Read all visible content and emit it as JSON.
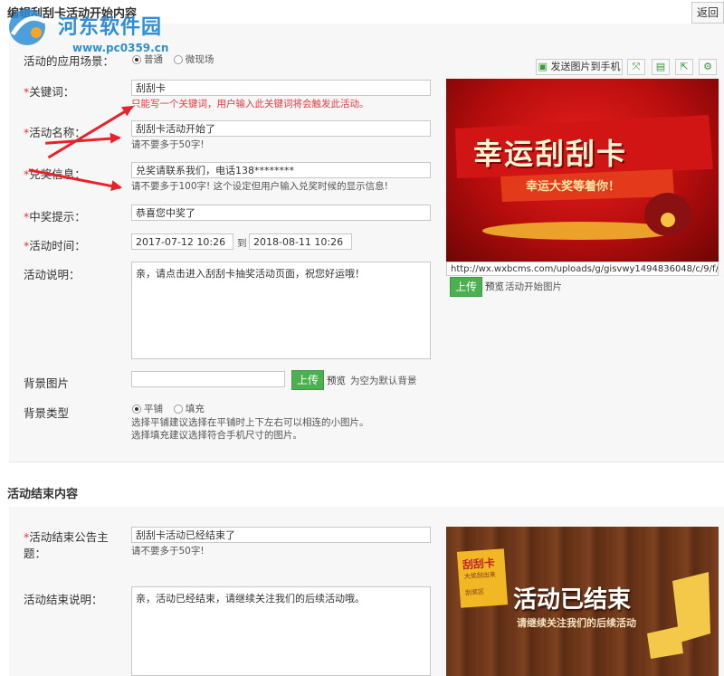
{
  "header": {
    "title": "编辑刮刮卡活动开始内容",
    "back_label": "返回"
  },
  "watermark": {
    "name": "河东软件园",
    "url": "www.pc0359.cn"
  },
  "scene": {
    "label": "活动的应用场景：",
    "options": [
      "普通",
      "微现场"
    ],
    "selected": "普通"
  },
  "toolbar": {
    "send_label": "发送图片到手机"
  },
  "keyword": {
    "label": "关键词：",
    "value": "刮刮卡",
    "hint": "只能写一个关键词，用户输入此关键词将会触发此活动。"
  },
  "name": {
    "label": "活动名称：",
    "value": "刮刮卡活动开始了",
    "hint": "请不要多于50字!"
  },
  "prize_info": {
    "label": "兑奖信息：",
    "value": "兑奖请联系我们，电话138********",
    "hint": "请不要多于100字! 这个设定但用户输入兑奖时候的显示信息!"
  },
  "win_tip": {
    "label": "中奖提示：",
    "value": "恭喜您中奖了"
  },
  "time": {
    "label": "活动时间：",
    "start": "2017-07-12 10:26",
    "to": "到",
    "end": "2018-08-11 10:26"
  },
  "desc": {
    "label": "活动说明：",
    "value": "亲，请点击进入刮刮卡抽奖活动页面，祝您好运哦！"
  },
  "start_image": {
    "url": "http://wx.wxbcms.com/uploads/g/gisvwy1494836048/c/9/f/3/th",
    "upload": "上传",
    "preview": "预览",
    "note": "活动开始图片",
    "banner_title": "幸运刮刮卡",
    "banner_sub": "幸运大奖等着你！"
  },
  "bg_image": {
    "label": "背景图片",
    "upload": "上传",
    "preview": "预览",
    "note": "为空为默认背景"
  },
  "bg_type": {
    "label": "背景类型",
    "options": [
      "平铺",
      "填充"
    ],
    "selected": "平铺",
    "hint1": "选择平铺建议选择在平铺时上下左右可以相连的小图片。",
    "hint2": "选择填充建议选择符合手机尺寸的图片。"
  },
  "end_section": {
    "title": "活动结束内容"
  },
  "end_subject": {
    "label": "活动结束公告主题：",
    "value": "刮刮卡活动已经结束了",
    "hint": "请不要多于50字!"
  },
  "end_desc": {
    "label": "活动结束说明：",
    "value": "亲，活动已经结束，请继续关注我们的后续活动哦。"
  },
  "end_banner": {
    "card_title": "刮刮卡",
    "card_sub": "大奖刮出来",
    "card_tag": "刮奖区",
    "title": "活动已结束",
    "sub": "请继续关注我们的后续活动"
  },
  "colors": {
    "accent_red": "#e4393c",
    "upload_green": "#4caf50",
    "panel_bg": "#f7f7f7"
  }
}
